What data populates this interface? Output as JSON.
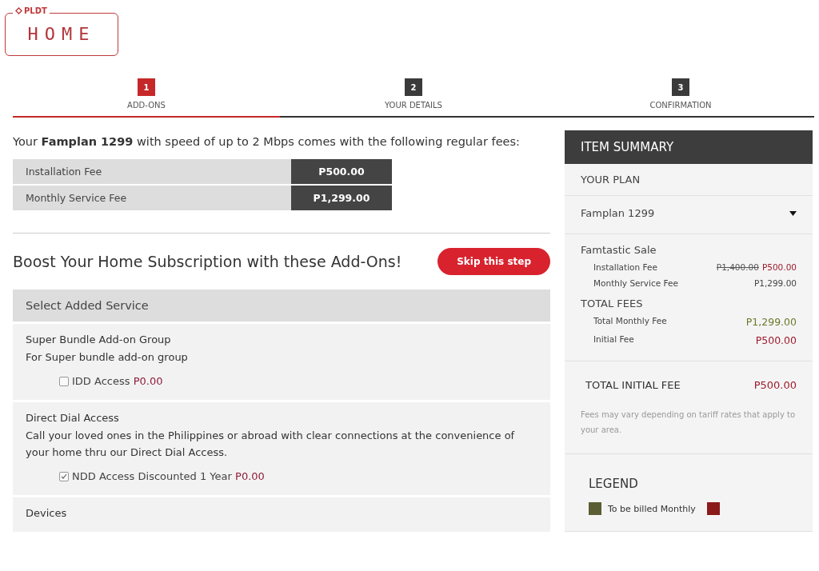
{
  "logo": {
    "brand": "PLDT",
    "product": "HOME"
  },
  "steps": [
    {
      "number": "1",
      "label": "ADD-ONS",
      "selected": true
    },
    {
      "number": "2",
      "label": "YOUR DETAILS",
      "selected": false
    },
    {
      "number": "3",
      "label": "CONFIRMATION",
      "selected": false
    }
  ],
  "intro": "Your **Famplan 1299** with speed of up to 2 Mbps comes with the following regular fees:",
  "fees": [
    {
      "label": "Installation Fee",
      "value": "P500.00"
    },
    {
      "label": "Monthly Service Fee",
      "value": "P1,299.00"
    }
  ],
  "addons_heading": "Boost Your Home Subscription with these Add-Ons!",
  "skip_button": "Skip this step",
  "select_header": "Select Added Service",
  "groups": [
    {
      "title": "Super Bundle Add-on Group",
      "description": "For Super bundle add-on group",
      "options": [
        {
          "label": "IDD Access",
          "price": "P0.00",
          "checked": false
        }
      ]
    },
    {
      "title": "Direct Dial Access",
      "description": "Call your loved ones in the Philippines or abroad with clear connections at the convenience of your home thru our Direct Dial Access.",
      "options": [
        {
          "label": "NDD Access Discounted 1 Year",
          "price": "P0.00",
          "checked": true
        }
      ]
    },
    {
      "title": "Devices"
    }
  ],
  "summary": {
    "title": "ITEM SUMMARY",
    "plan_label": "YOUR PLAN",
    "plan": "Famplan 1299",
    "sale_title": "Famtastic Sale",
    "sale_items": [
      {
        "label": "Installation Fee",
        "old": "P1,400.00",
        "value": "P500.00"
      },
      {
        "label": "Monthly Service Fee",
        "value": "P1,299.00"
      }
    ],
    "totals_title": "TOTAL FEES",
    "totals": [
      {
        "label": "Total Monthly Fee",
        "value": "P1,299.00",
        "color": "#6b7a2a"
      },
      {
        "label": "Initial Fee",
        "value": "P500.00",
        "color": "#9b1b2a"
      }
    ],
    "total_initial_label": "TOTAL INITIAL FEE",
    "total_initial_value": "P500.00",
    "note": "Fees may vary depending on tariff rates that apply to your area.",
    "legend_title": "LEGEND",
    "legend": [
      {
        "label": "To be billed Monthly",
        "color": "#5b5e35"
      },
      {
        "color": "#8b1a1a"
      }
    ]
  }
}
